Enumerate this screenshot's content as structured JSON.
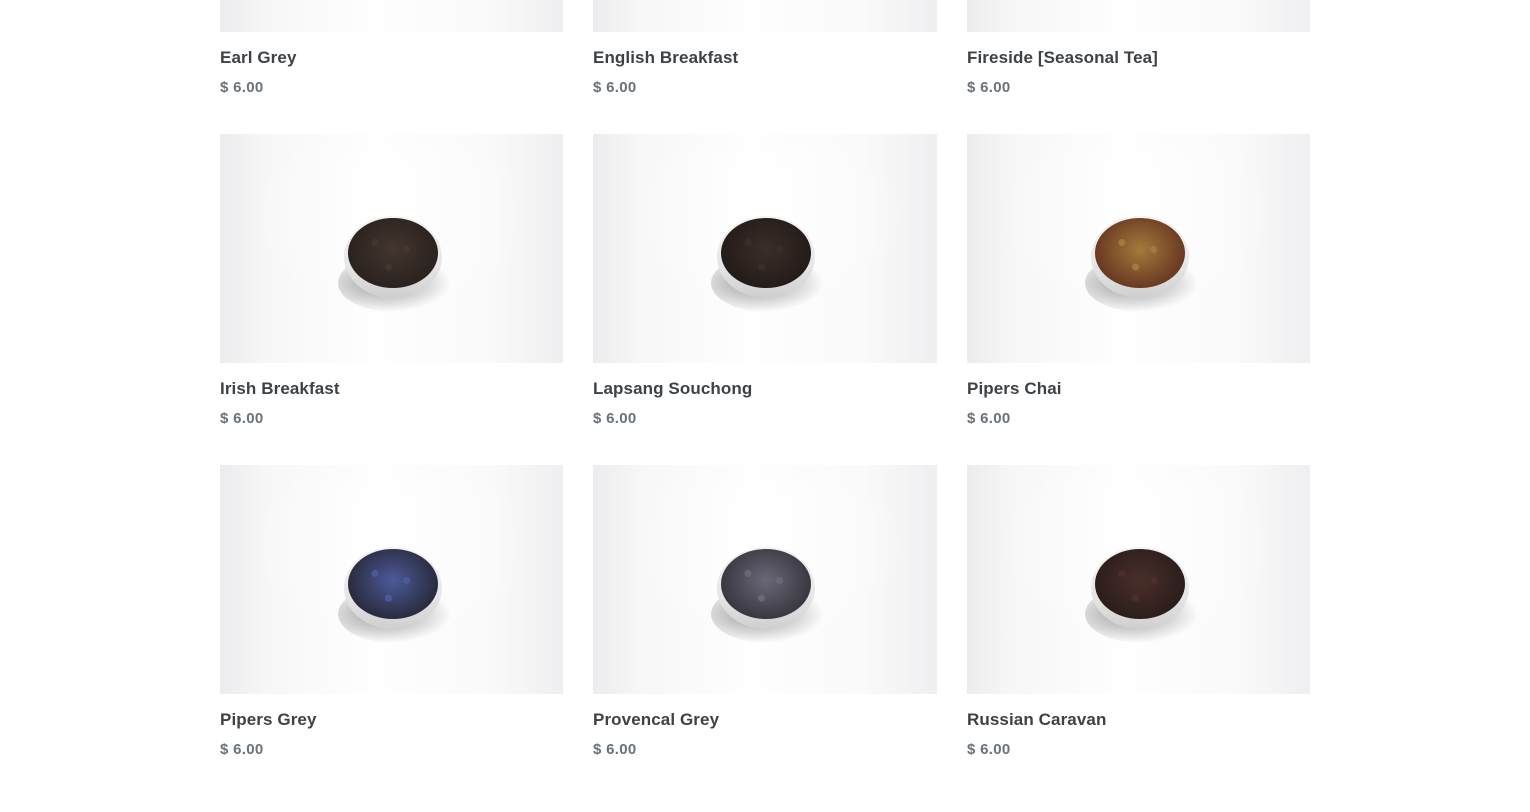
{
  "currency_symbol": "$",
  "products": [
    {
      "name": "Earl Grey",
      "price": "$ 6.00",
      "tea_color": "#2e2420",
      "tea_color_2": "#4a3a30"
    },
    {
      "name": "English Breakfast",
      "price": "$ 6.00",
      "tea_color": "#2a201d",
      "tea_color_2": "#3f322b"
    },
    {
      "name": "Fireside [Seasonal Tea]",
      "price": "$ 6.00",
      "tea_color": "#5a3a24",
      "tea_color_2": "#8a6236"
    },
    {
      "name": "Irish Breakfast",
      "price": "$ 6.00",
      "tea_color": "#2b231f",
      "tea_color_2": "#43362e"
    },
    {
      "name": "Lapsang Souchong",
      "price": "$ 6.00",
      "tea_color": "#241c1a",
      "tea_color_2": "#3a2e28"
    },
    {
      "name": "Pipers Chai",
      "price": "$ 6.00",
      "tea_color": "#6a3a22",
      "tea_color_2": "#a47a3c"
    },
    {
      "name": "Pipers Grey",
      "price": "$ 6.00",
      "tea_color": "#2a2c3e",
      "tea_color_2": "#4c5a9a"
    },
    {
      "name": "Provencal Grey",
      "price": "$ 6.00",
      "tea_color": "#3a3840",
      "tea_color_2": "#6a6878"
    },
    {
      "name": "Russian Caravan",
      "price": "$ 6.00",
      "tea_color": "#2c1e1c",
      "tea_color_2": "#4a2f2a"
    }
  ]
}
